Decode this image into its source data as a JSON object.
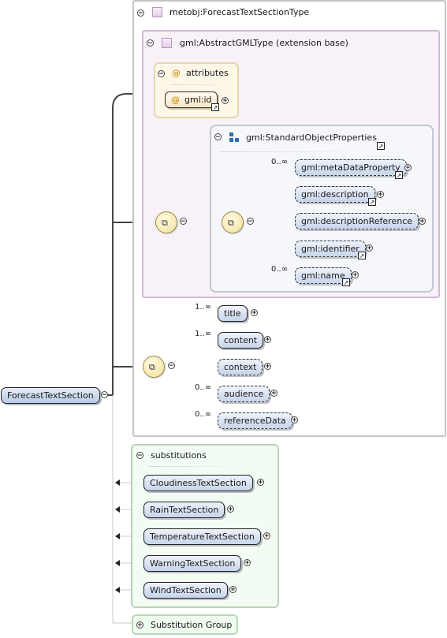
{
  "root_element": {
    "name": "ForecastTextSection",
    "collapse_symbol": "−"
  },
  "complex_type": {
    "name": "metobj:ForecastTextSectionType",
    "extension_base": {
      "title": "gml:AbstractGMLType (extension base)",
      "attributes": {
        "label": "attributes",
        "items": [
          {
            "name": "gml:id"
          }
        ]
      },
      "standard_object_properties": {
        "title": "gml:StandardObjectProperties",
        "elements": [
          {
            "name": "gml:metaDataProperty",
            "cardinality": "0..∞",
            "optional": true,
            "has_link": true
          },
          {
            "name": "gml:description",
            "cardinality": "",
            "optional": true,
            "has_link": true
          },
          {
            "name": "gml:descriptionReference",
            "cardinality": "",
            "optional": true,
            "has_link": false
          },
          {
            "name": "gml:identifier",
            "cardinality": "",
            "optional": true,
            "has_link": true
          },
          {
            "name": "gml:name",
            "cardinality": "0..∞",
            "optional": true,
            "has_link": true
          }
        ]
      }
    },
    "sequence_elements": [
      {
        "name": "title",
        "cardinality": "1..∞",
        "optional": false
      },
      {
        "name": "content",
        "cardinality": "1..∞",
        "optional": false
      },
      {
        "name": "context",
        "cardinality": "",
        "optional": true
      },
      {
        "name": "audience",
        "cardinality": "0..∞",
        "optional": true
      },
      {
        "name": "referenceData",
        "cardinality": "0..∞",
        "optional": true
      }
    ]
  },
  "substitutions": {
    "label": "substitutions",
    "items": [
      {
        "name": "CloudinessTextSection"
      },
      {
        "name": "RainTextSection"
      },
      {
        "name": "TemperatureTextSection"
      },
      {
        "name": "WarningTextSection"
      },
      {
        "name": "WindTextSection"
      }
    ]
  },
  "substitution_group": {
    "label": "Substitution Group"
  },
  "symbols": {
    "collapse": "−",
    "expand": "+",
    "at_sign": "@",
    "link_arrow": "↗"
  },
  "colors": {
    "element_fill": "#c7d4ea",
    "type_border": "#c4c4c4",
    "base_fill": "#f8f1f8",
    "attributes_fill": "#fdf7e8",
    "substitutions_fill": "#f2fcf2"
  }
}
